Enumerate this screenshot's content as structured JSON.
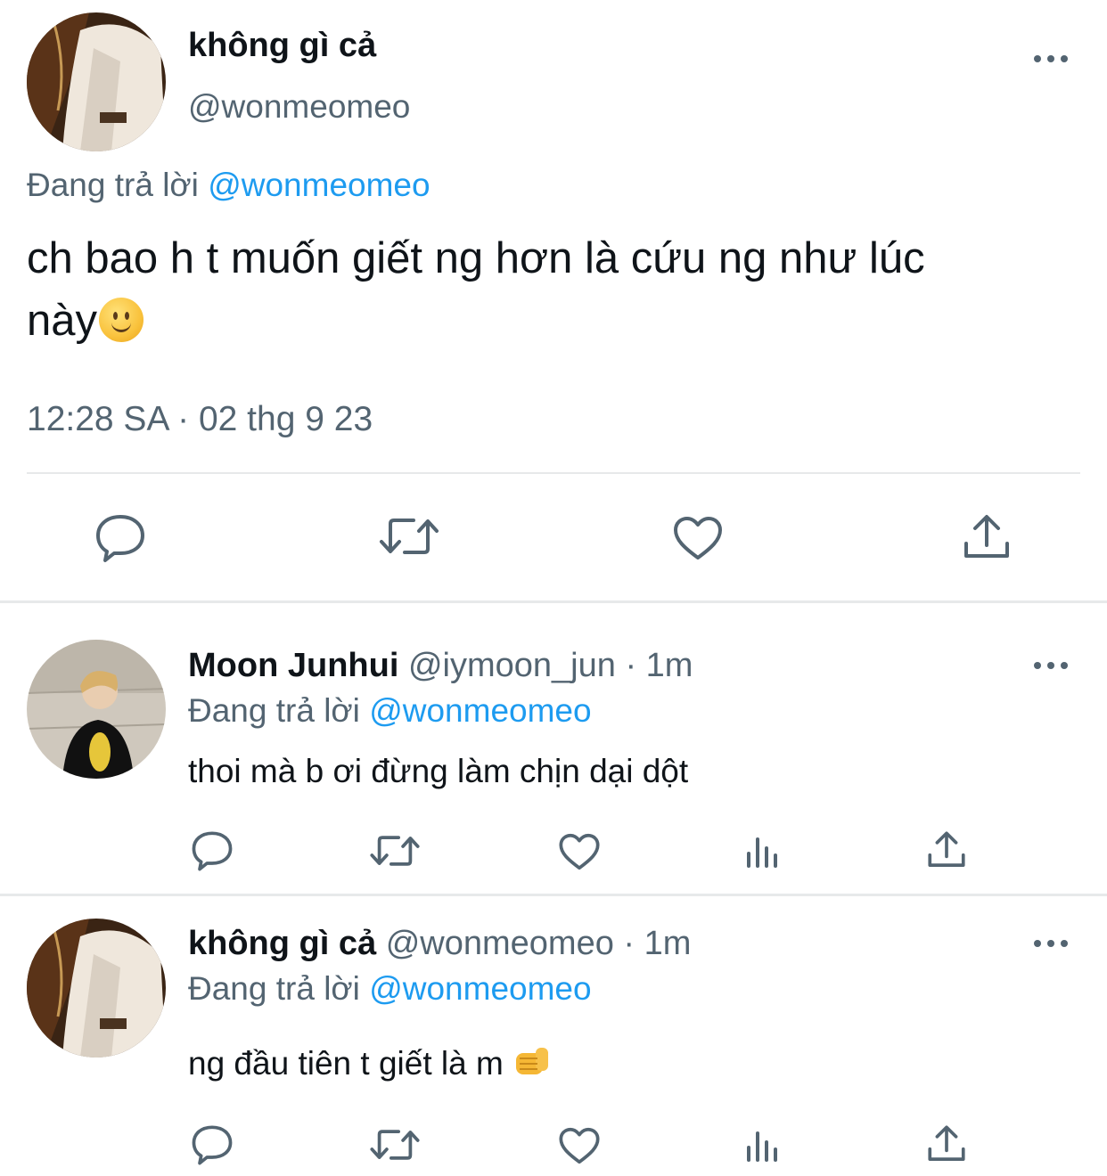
{
  "main_tweet": {
    "display_name": "không gì cả",
    "handle": "@wonmeomeo",
    "replying_prefix": "Đang trả lời",
    "replying_to": "@wonmeomeo",
    "text_line1": "ch bao h t muốn giết ng hơn là cứu ng như lúc",
    "text_line2": "này",
    "emoji": "slightly-smiling-face-emoji",
    "timestamp": "12:28 SA · 02 thg 9 23",
    "actions": [
      "reply-icon",
      "retweet-icon",
      "like-icon",
      "share-icon"
    ]
  },
  "replies": [
    {
      "display_name": "Moon Junhui",
      "handle": "@iymoon_jun",
      "time": "· 1m",
      "replying_prefix": "Đang trả lời",
      "replying_to": "@wonmeomeo",
      "text": "thoi mà b ơi đừng làm chịn dại dột",
      "actions": [
        "reply-icon",
        "retweet-icon",
        "like-icon",
        "views-icon",
        "share-icon"
      ]
    },
    {
      "display_name": "không gì cả",
      "handle": "@wonmeomeo",
      "time": "· 1m",
      "replying_prefix": "Đang trả lời",
      "replying_to": "@wonmeomeo",
      "text": "ng đầu tiên t giết là m",
      "emoji": "fist-emoji",
      "actions": [
        "reply-icon",
        "retweet-icon",
        "like-icon",
        "views-icon",
        "share-icon"
      ]
    }
  ],
  "colors": {
    "link": "#1d9bf0",
    "secondary": "#536471",
    "divider": "#e7e9ea"
  }
}
